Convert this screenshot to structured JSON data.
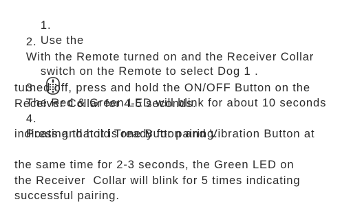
{
  "steps": [
    {
      "number": "1.",
      "line1_before_icon": "Use the",
      "icon": "remote-dog-switch-icon",
      "line1_after_icon": "switch on the Remote to select Dog 1 .",
      "lines": []
    },
    {
      "number": "2.",
      "line1": "With the Remote turned on and the Receiver Collar",
      "lines": [
        "turned off, press and hold the ON/OFF Button on the",
        "Receiver Collar for 4-5 seconds."
      ]
    },
    {
      "number": "3.",
      "line1": "The Red & Green LED will blink for about 10 seconds",
      "lines": [
        "indicating that it is ready for pairing."
      ]
    },
    {
      "number": "4.",
      "line1": "Press and hold Tone Button and Vibration Button at",
      "lines": [
        "the same time for 2-3 seconds, the Green LED on",
        "the Receiver  Collar will blink for 5 times indicating",
        "successful pairing."
      ]
    }
  ]
}
